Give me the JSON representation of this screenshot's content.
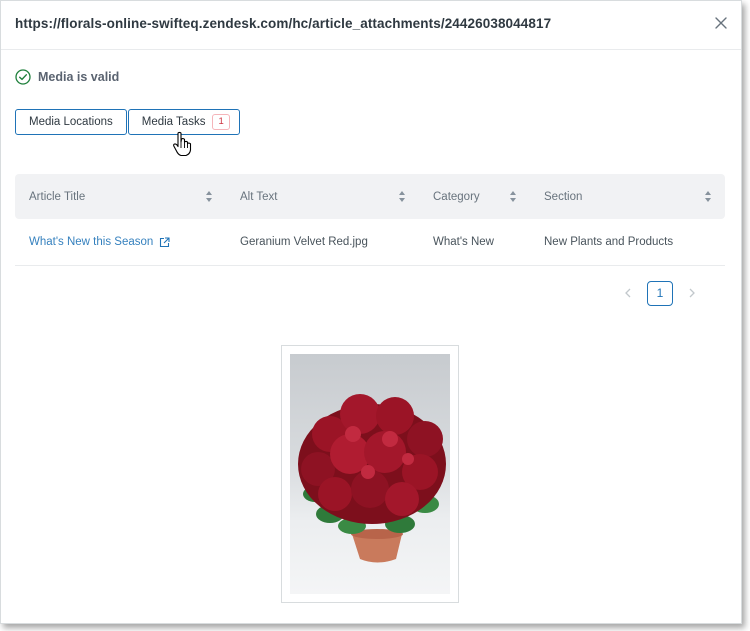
{
  "modal": {
    "title": "https://florals-online-swifteq.zendesk.com/hc/article_attachments/24426038044817",
    "close_icon": "close-icon"
  },
  "status": {
    "text": "Media is valid",
    "icon": "check-circle-icon",
    "color": "#1d7f3a"
  },
  "tabs": [
    {
      "label": "Media Locations"
    },
    {
      "label": "Media Tasks",
      "badge": "1"
    }
  ],
  "table": {
    "columns": [
      "Article Title",
      "Alt Text",
      "Category",
      "Section"
    ],
    "rows": [
      {
        "article_title": "What's New this Season",
        "alt_text": "Geranium Velvet Red.jpg",
        "category": "What's New",
        "section": "New Plants and Products"
      }
    ]
  },
  "pagination": {
    "current": "1"
  },
  "colors": {
    "accent": "#1f73b7",
    "badge": "#cc3340",
    "header_bg": "#f1f2f4"
  }
}
